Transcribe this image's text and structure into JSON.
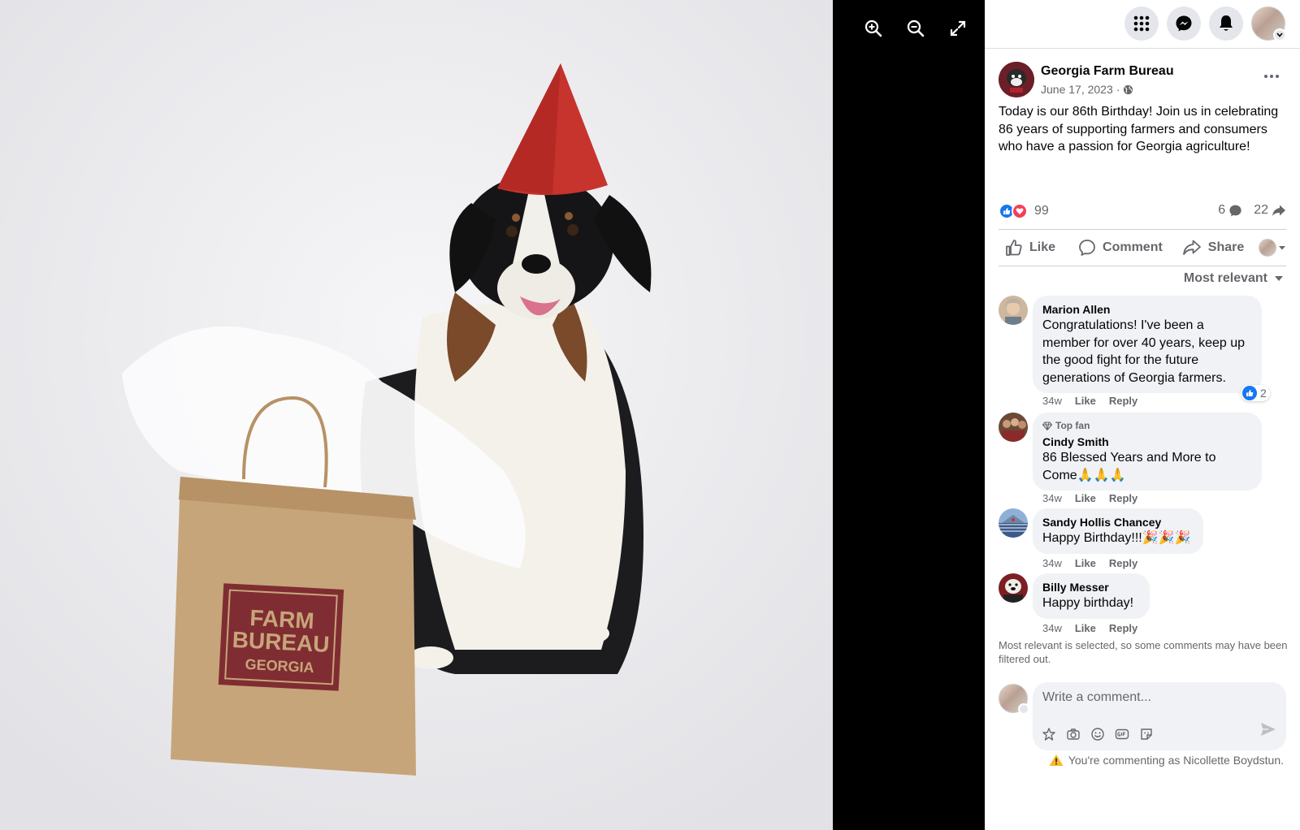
{
  "viewer": {
    "tools": [
      {
        "icon": "zoom-in-icon",
        "name": "zoom-in-button"
      },
      {
        "icon": "zoom-out-icon",
        "name": "zoom-out-button"
      },
      {
        "icon": "fullscreen-icon",
        "name": "fullscreen-button"
      }
    ],
    "photo": {
      "bag_logo": [
        "FARM",
        "BUREAU",
        "GEORGIA"
      ]
    }
  },
  "topnav": {
    "icons": [
      "menu-grid-icon",
      "messenger-icon",
      "notifications-bell-icon"
    ]
  },
  "post": {
    "page_name": "Georgia Farm Bureau",
    "date": "June 17, 2023",
    "date_separator": "·",
    "text": "Today is our 86th Birthday! Join us in celebrating 86 years of supporting farmers and consumers who have a passion for Georgia agriculture!",
    "reaction_count": "99",
    "comment_count": "6",
    "share_count": "22"
  },
  "actions": {
    "like": "Like",
    "comment": "Comment",
    "share": "Share"
  },
  "sort_label": "Most relevant",
  "comments": [
    {
      "name": "Marion Allen",
      "text": "Congratulations! I've been a member for over 40 years, keep up the good fight for the future generations of Georgia farmers.",
      "time": "34w",
      "like": "Like",
      "reply": "Reply",
      "reaction_count": "2"
    },
    {
      "badge": "Top fan",
      "name": "Cindy Smith",
      "text": "86 Blessed Years and More to Come🙏🙏🙏",
      "time": "34w",
      "like": "Like",
      "reply": "Reply"
    },
    {
      "name": "Sandy Hollis Chancey",
      "text": "Happy Birthday!!!🎉🎉🎉",
      "time": "34w",
      "like": "Like",
      "reply": "Reply"
    },
    {
      "name": "Billy Messer",
      "text": "Happy birthday!",
      "time": "34w",
      "like": "Like",
      "reply": "Reply"
    }
  ],
  "filter_note": "Most relevant is selected, so some comments may have been filtered out.",
  "composer": {
    "placeholder": "Write a comment...",
    "tools": [
      "avatar-sticker-icon",
      "camera-icon",
      "emoji-icon",
      "gif-icon",
      "sticker-icon"
    ],
    "commenting_as": "You're commenting as Nicollette Boydstun."
  },
  "colors": {
    "accent": "#1877f2",
    "love": "#f33e58",
    "secondary_text": "#65676b",
    "bubble": "#f0f2f5"
  }
}
